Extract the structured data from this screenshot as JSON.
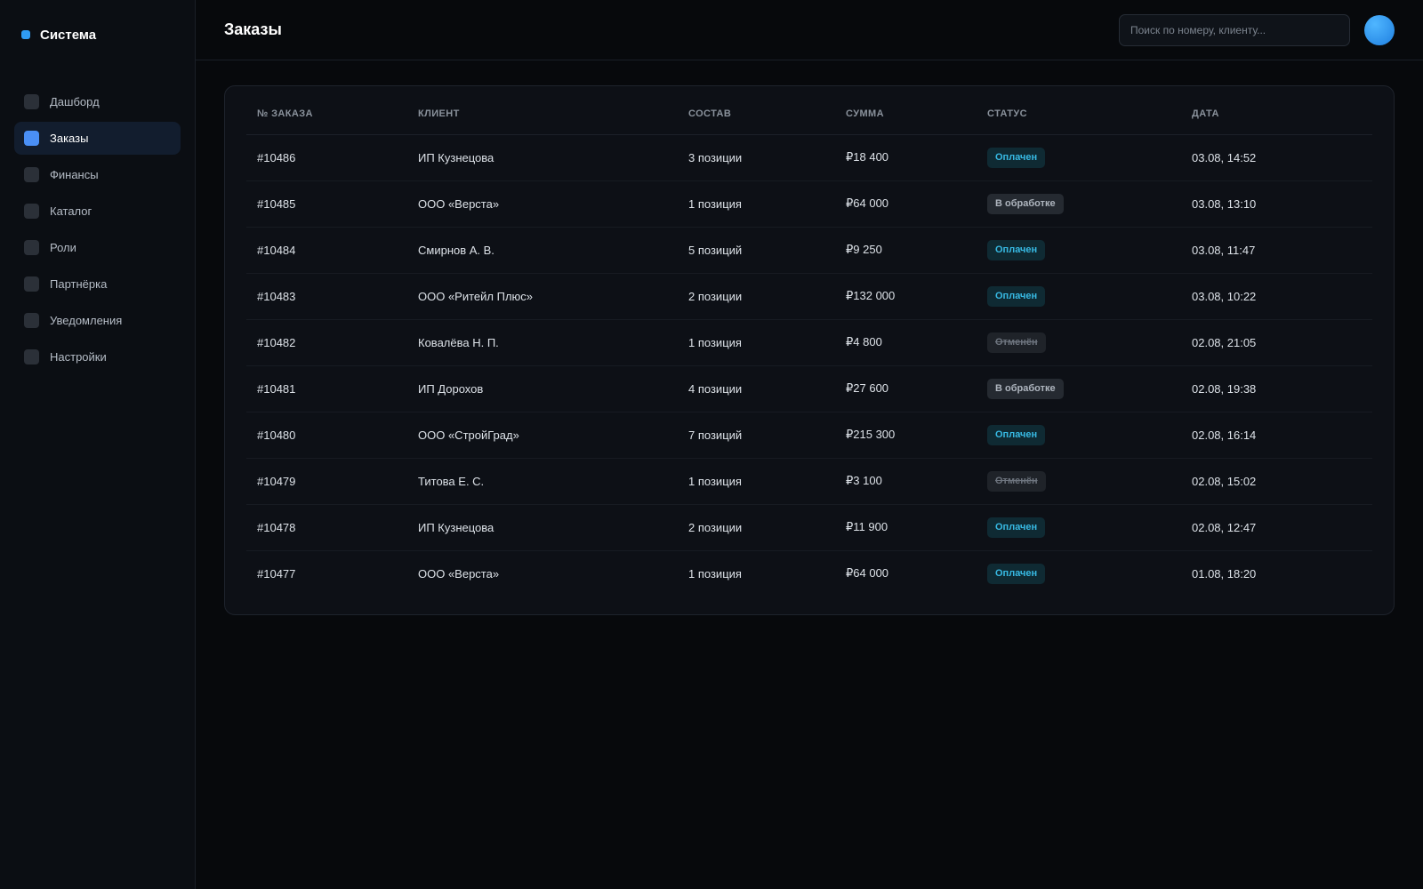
{
  "brand": {
    "name": "Система",
    "accent": "#2f9bf2"
  },
  "sidebar": {
    "items": [
      {
        "label": "Дашборд",
        "key": "dashboard",
        "active": false
      },
      {
        "label": "Заказы",
        "key": "orders",
        "active": true
      },
      {
        "label": "Финансы",
        "key": "finance",
        "active": false
      },
      {
        "label": "Каталог",
        "key": "catalog",
        "active": false
      },
      {
        "label": "Роли",
        "key": "roles",
        "active": false
      },
      {
        "label": "Партнёрка",
        "key": "partners",
        "active": false
      },
      {
        "label": "Уведомления",
        "key": "notifications",
        "active": false
      },
      {
        "label": "Настройки",
        "key": "settings",
        "active": false
      }
    ]
  },
  "header": {
    "title": "Заказы",
    "search": {
      "placeholder": "Поиск по номеру, клиенту...",
      "value": ""
    },
    "avatar_icon": "user-avatar-icon"
  },
  "table": {
    "columns": [
      "№ ЗАКАЗА",
      "КЛИЕНТ",
      "СОСТАВ",
      "СУММА",
      "СТАТУС",
      "ДАТА"
    ],
    "rows": [
      {
        "id": "#10486",
        "client": "ИП Кузнецова",
        "items": "3 позиции",
        "sum": "₽18 400",
        "status": "Оплачен",
        "status_type": "paid",
        "date": "03.08, 14:52"
      },
      {
        "id": "#10485",
        "client": "ООО «Верста»",
        "items": "1 позиция",
        "sum": "₽64 000",
        "status": "В обработке",
        "status_type": "processing",
        "date": "03.08, 13:10"
      },
      {
        "id": "#10484",
        "client": "Смирнов А. В.",
        "items": "5 позиций",
        "sum": "₽9 250",
        "status": "Оплачен",
        "status_type": "paid",
        "date": "03.08, 11:47"
      },
      {
        "id": "#10483",
        "client": "ООО «Ритейл Плюс»",
        "items": "2 позиции",
        "sum": "₽132 000",
        "status": "Оплачен",
        "status_type": "paid",
        "date": "03.08, 10:22"
      },
      {
        "id": "#10482",
        "client": "Ковалёва Н. П.",
        "items": "1 позиция",
        "sum": "₽4 800",
        "status": "Отменён",
        "status_type": "cancelled",
        "date": "02.08, 21:05"
      },
      {
        "id": "#10481",
        "client": "ИП Дорохов",
        "items": "4 позиции",
        "sum": "₽27 600",
        "status": "В обработке",
        "status_type": "processing",
        "date": "02.08, 19:38"
      },
      {
        "id": "#10480",
        "client": "ООО «СтройГрад»",
        "items": "7 позиций",
        "sum": "₽215 300",
        "status": "Оплачен",
        "status_type": "paid",
        "date": "02.08, 16:14"
      },
      {
        "id": "#10479",
        "client": "Титова Е. С.",
        "items": "1 позиция",
        "sum": "₽3 100",
        "status": "Отменён",
        "status_type": "cancelled",
        "date": "02.08, 15:02"
      },
      {
        "id": "#10478",
        "client": "ИП Кузнецова",
        "items": "2 позиции",
        "sum": "₽11 900",
        "status": "Оплачен",
        "status_type": "paid",
        "date": "02.08, 12:47"
      },
      {
        "id": "#10477",
        "client": "ООО «Верста»",
        "items": "1 позиция",
        "sum": "₽64 000",
        "status": "Оплачен",
        "status_type": "paid",
        "date": "01.08, 18:20"
      }
    ]
  },
  "colors": {
    "background": "#07090c",
    "paid": "#37b9e3",
    "processing": "#aeb5be",
    "cancelled": "#6d747e",
    "active_nav": "#4a8ff5"
  }
}
